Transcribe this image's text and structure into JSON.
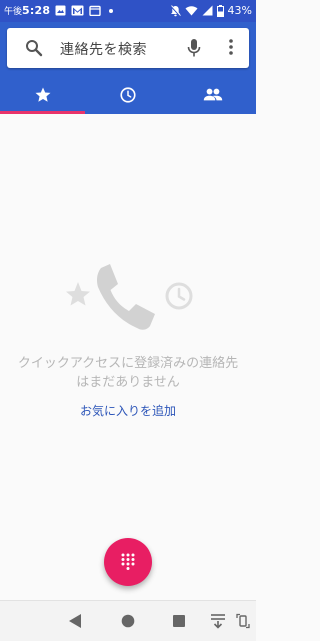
{
  "status_bar": {
    "time_prefix": "午後",
    "time": "5:28",
    "battery": "43%"
  },
  "search": {
    "placeholder": "連絡先を検索"
  },
  "tabs": [
    {
      "icon": "star-icon",
      "active": true
    },
    {
      "icon": "clock-icon",
      "active": false
    },
    {
      "icon": "people-icon",
      "active": false
    }
  ],
  "empty_state": {
    "message": "クイックアクセスに登録済みの連絡先はまだありません",
    "add_favorite_label": "お気に入りを追加"
  },
  "colors": {
    "app_bar": "#3060cc",
    "status_bar": "#2f52c6",
    "tab_indicator": "#e8336a",
    "fab": "#e81e63",
    "link": "#2c55b8"
  }
}
